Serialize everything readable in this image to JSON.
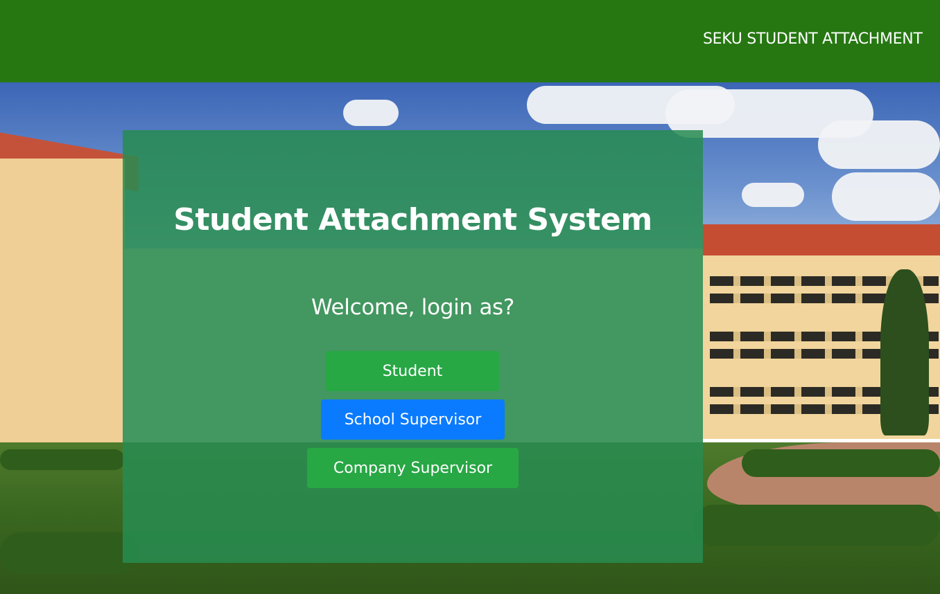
{
  "header": {
    "title": "SEKU STUDENT ATTACHMENT"
  },
  "login_panel": {
    "title": "Student Attachment System",
    "subtitle": "Welcome, login as?",
    "buttons": {
      "student": "Student",
      "school_supervisor": "School Supervisor",
      "company_supervisor": "Company Supervisor"
    }
  },
  "colors": {
    "header_bg": "#267712",
    "panel_bg": "rgba(40, 140, 80, 0.86)",
    "success": "#28a745",
    "primary": "#0a7bff"
  }
}
